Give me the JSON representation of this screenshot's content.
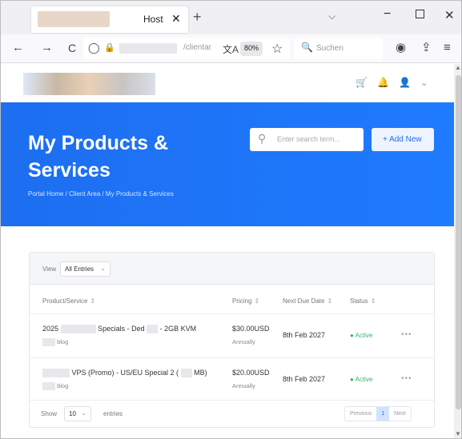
{
  "browser": {
    "tab_title": "Host",
    "tab_close": "✕",
    "new_tab": "+",
    "tabs_menu": "⌵",
    "minimize": "−",
    "close": "✕",
    "back": "←",
    "forward": "→",
    "reload": "C",
    "shield": "◯",
    "lock": "🔒",
    "url_tail": "/clientar",
    "translate": "文A",
    "zoom": "80%",
    "star": "☆",
    "search_placeholder": "Suchen",
    "search_icon": "🔍",
    "account": "◉",
    "extensions": "⇪",
    "menu": "≡"
  },
  "header": {
    "icons": "🛒🔔👤⌄"
  },
  "hero": {
    "title": "My Products & Services",
    "breadcrumb": "Portal Home / Client Area / My Products & Services",
    "search_placeholder": "Enter search term...",
    "add_new": "+ Add New"
  },
  "table": {
    "view_label": "View",
    "filter_value": "All Entries",
    "columns": [
      "Product/Service",
      "Pricing",
      "Next Due Date",
      "Status"
    ],
    "sort_icon": "⇕",
    "rows": [
      {
        "product_prefix": "2025",
        "product_mid": "Specials - Ded",
        "product_suffix": "- 2GB KVM",
        "domain_suffix": "blog",
        "price": "$30.00USD",
        "cycle": "Annually",
        "due": "8th Feb 2027",
        "status": "Active"
      },
      {
        "product_prefix": "",
        "product_mid": "VPS (Promo) - US/EU Special 2 (",
        "product_suffix": "MB)",
        "domain_suffix": "blog",
        "price": "$20.00USD",
        "cycle": "Annually",
        "due": "8th Feb 2027",
        "status": "Active"
      }
    ],
    "status_dot": "●",
    "more": "•••",
    "show_label": "Show",
    "show_value": "10",
    "entries_label": "entries",
    "prev": "Previous",
    "page": "1",
    "next": "Next"
  }
}
